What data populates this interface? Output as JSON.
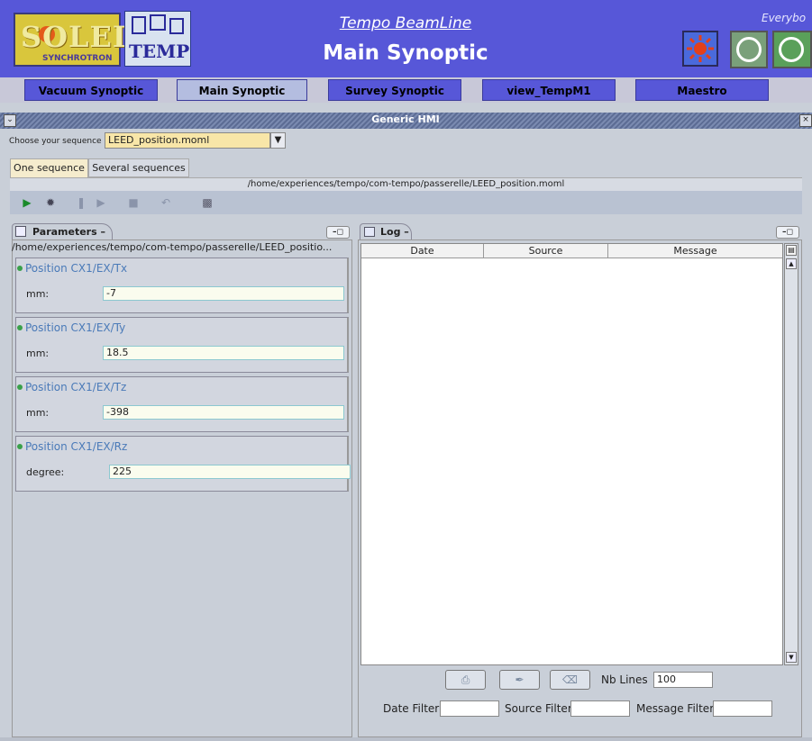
{
  "header": {
    "logo_text": "SOLEIL",
    "logo_subtext": "SYNCHROTRON",
    "logo2_text": "TEMPO",
    "title_small": "Tempo BeamLine",
    "title_main": "Main Synoptic",
    "user": "Everybo"
  },
  "nav": {
    "items": [
      {
        "label": "Vacuum Synoptic"
      },
      {
        "label": "Main Synoptic"
      },
      {
        "label": "Survey Synoptic"
      },
      {
        "label": "view_TempM1"
      },
      {
        "label": "Maestro"
      }
    ],
    "active": "Main Synoptic"
  },
  "hmi": {
    "title": "Generic HMI"
  },
  "sequence": {
    "label": "Choose your sequence",
    "selected": "LEED_position.moml"
  },
  "tabs": [
    {
      "label": "One sequence"
    },
    {
      "label": "Several sequences"
    }
  ],
  "path": "/home/experiences/tempo/com-tempo/passerelle/LEED_position.moml",
  "parameters": {
    "tab_label": "Parameters",
    "path": "/home/experiences/tempo/com-tempo/passerelle/LEED_positio...",
    "groups": [
      {
        "title": "Position CX1/EX/Tx",
        "unit": "mm:",
        "value": "-7"
      },
      {
        "title": "Position CX1/EX/Ty",
        "unit": "mm:",
        "value": "18.5"
      },
      {
        "title": "Position CX1/EX/Tz",
        "unit": "mm:",
        "value": "-398"
      },
      {
        "title": "Position CX1/EX/Rz",
        "unit": "degree:",
        "value": "225"
      }
    ]
  },
  "log": {
    "tab_label": "Log",
    "columns": [
      "Date",
      "Source",
      "Message"
    ],
    "rows": [],
    "nb_lines_label": "Nb Lines",
    "nb_lines": "100",
    "date_filter_label": "Date Filter",
    "source_filter_label": "Source Filter",
    "message_filter_label": "Message Filter"
  },
  "colors": {
    "header_bg": "#5757d8",
    "nav_active": "#b4bde0",
    "param_title": "#4a7ab8",
    "sequence_select_bg": "#f8e6a8"
  }
}
